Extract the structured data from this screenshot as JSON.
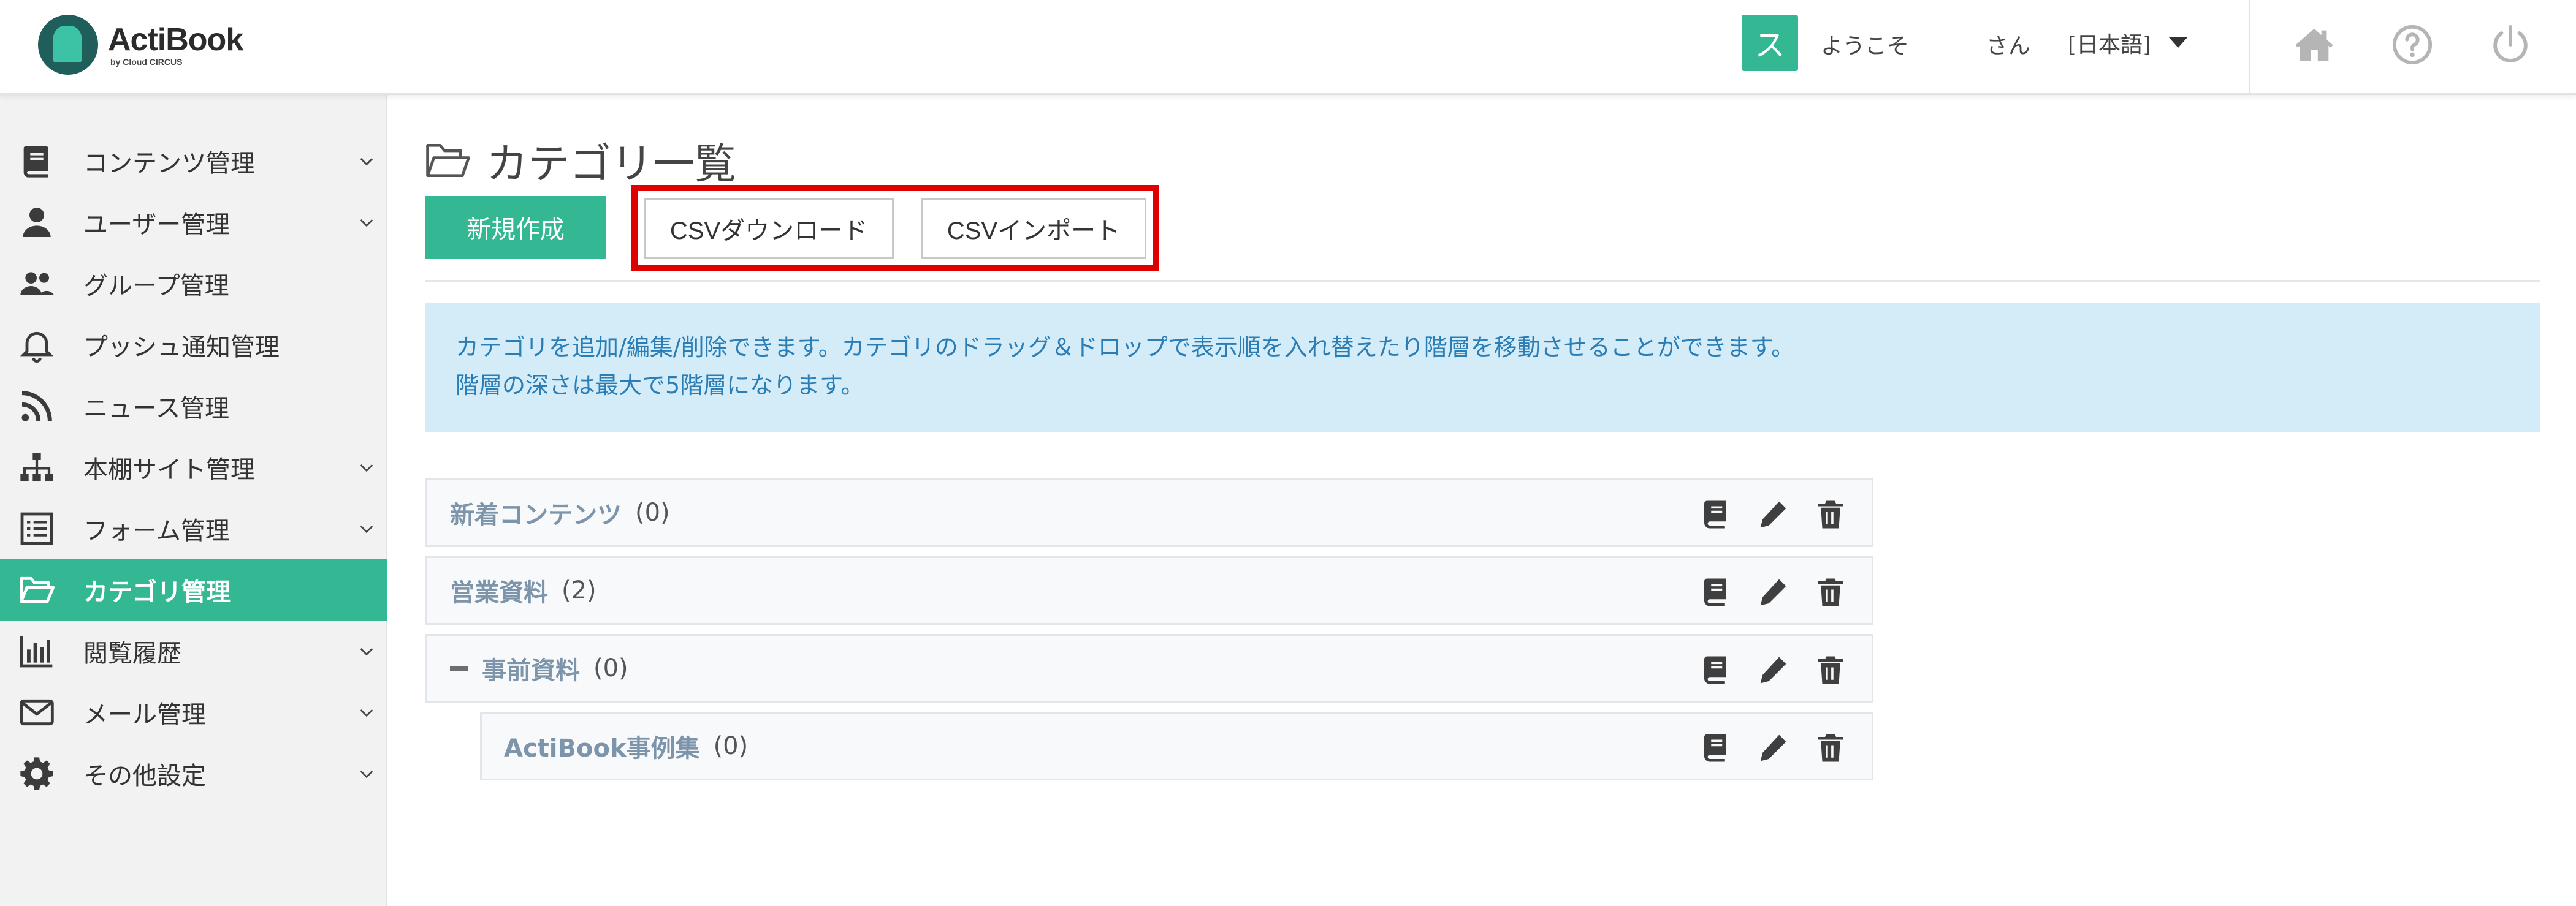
{
  "header": {
    "app_name": "ActiBook",
    "app_sub": "by Cloud CIRCUS",
    "avatar_initial": "ス",
    "welcome": "ようこそ",
    "san": "さん",
    "language": "[日本語]",
    "icons": [
      "home-icon",
      "help-icon",
      "power-icon"
    ]
  },
  "sidebar": {
    "items": [
      {
        "label": "コンテンツ管理",
        "icon": "book-icon",
        "expandable": true
      },
      {
        "label": "ユーザー管理",
        "icon": "user-icon",
        "expandable": true
      },
      {
        "label": "グループ管理",
        "icon": "users-icon",
        "expandable": false
      },
      {
        "label": "プッシュ通知管理",
        "icon": "bell-icon",
        "expandable": false
      },
      {
        "label": "ニュース管理",
        "icon": "rss-icon",
        "expandable": false
      },
      {
        "label": "本棚サイト管理",
        "icon": "sitemap-icon",
        "expandable": true
      },
      {
        "label": "フォーム管理",
        "icon": "form-icon",
        "expandable": true
      },
      {
        "label": "カテゴリ管理",
        "icon": "folder-open-icon",
        "expandable": false,
        "active": true
      },
      {
        "label": "閲覧履歴",
        "icon": "bar-chart-icon",
        "expandable": true
      },
      {
        "label": "メール管理",
        "icon": "mail-icon",
        "expandable": true
      },
      {
        "label": "その他設定",
        "icon": "gear-icon",
        "expandable": true
      }
    ]
  },
  "main": {
    "title": "カテゴリ一覧",
    "buttons": {
      "new": "新規作成",
      "csv_download": "CSVダウンロード",
      "csv_import": "CSVインポート"
    },
    "info_lines": [
      "カテゴリを追加/編集/削除できます。カテゴリのドラッグ＆ドロップで表示順を入れ替えたり階層を移動させることができます。",
      "階層の深さは最大で5階層になります。"
    ],
    "categories": [
      {
        "name": "新着コンテンツ",
        "count": "(0)"
      },
      {
        "name": "営業資料",
        "count": "(2)"
      },
      {
        "name": "事前資料",
        "count": "(0)",
        "collapsible": true
      },
      {
        "name": "ActiBook事例集",
        "count": "(0)",
        "child": true
      }
    ]
  },
  "colors": {
    "accent": "#34b793",
    "highlight": "#e00000",
    "info_bg": "#d4ecf8",
    "info_text": "#2a7db5"
  }
}
